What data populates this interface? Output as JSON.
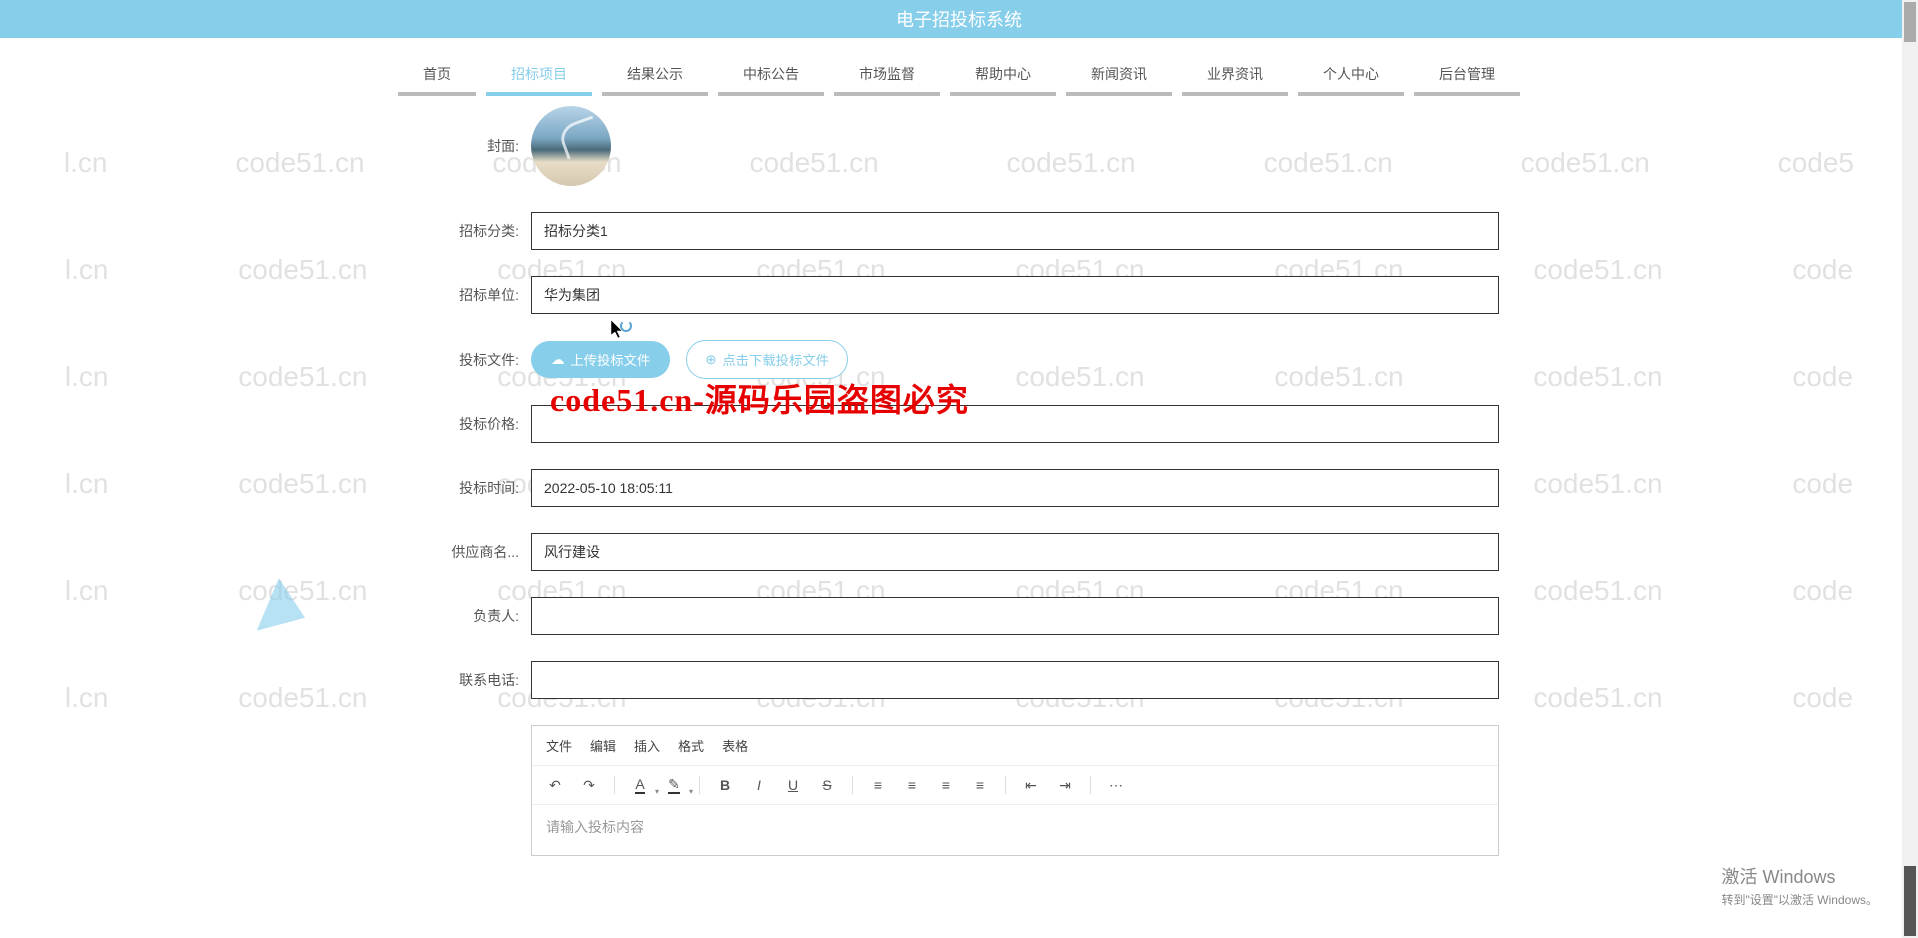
{
  "header": {
    "title": "电子招投标系统"
  },
  "nav": {
    "items": [
      {
        "label": "首页",
        "active": false
      },
      {
        "label": "招标项目",
        "active": true
      },
      {
        "label": "结果公示",
        "active": false
      },
      {
        "label": "中标公告",
        "active": false
      },
      {
        "label": "市场监督",
        "active": false
      },
      {
        "label": "帮助中心",
        "active": false
      },
      {
        "label": "新闻资讯",
        "active": false
      },
      {
        "label": "业界资讯",
        "active": false
      },
      {
        "label": "个人中心",
        "active": false
      },
      {
        "label": "后台管理",
        "active": false
      }
    ]
  },
  "form": {
    "cover_label": "封面:",
    "category_label": "招标分类:",
    "category_value": "招标分类1",
    "unit_label": "招标单位:",
    "unit_value": "华为集团",
    "bidfile_label": "投标文件:",
    "upload_btn": "上传投标文件",
    "download_btn": "点击下载投标文件",
    "price_label": "投标价格:",
    "price_value": "",
    "time_label": "投标时间:",
    "time_value": "2022-05-10 18:05:11",
    "supplier_label": "供应商名...",
    "supplier_value": "风行建设",
    "manager_label": "负责人:",
    "manager_value": "",
    "phone_label": "联系电话:",
    "phone_value": "",
    "editor": {
      "menu": [
        "文件",
        "编辑",
        "插入",
        "格式",
        "表格"
      ],
      "placeholder": "请输入投标内容"
    }
  },
  "watermark_text": "code51.cn",
  "red_overlay": "code51.cn-源码乐园盗图必究",
  "windows": {
    "line1": "激活 Windows",
    "line2": "转到\"设置\"以激活 Windows。"
  }
}
